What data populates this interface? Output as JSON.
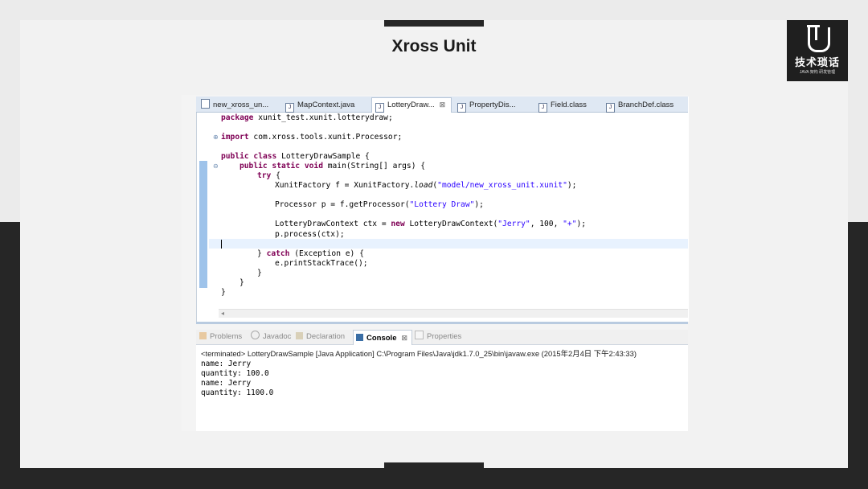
{
  "slide": {
    "title": "Xross Unit"
  },
  "logo": {
    "letter": "J",
    "name": "技术琐话",
    "sub": "JAVA 架构 研发管理"
  },
  "editor_tabs": [
    {
      "label": "new_xross_un...",
      "icon": "xross-file-icon"
    },
    {
      "label": "MapContext.java",
      "icon": "java-file-icon"
    },
    {
      "label": "LotteryDraw...",
      "icon": "java-file-icon",
      "active": true,
      "close": "⊠"
    },
    {
      "label": "PropertyDis...",
      "icon": "java-file-icon"
    },
    {
      "label": "Field.class",
      "icon": "class-file-icon"
    },
    {
      "label": "BranchDef.class",
      "icon": "class-file-icon"
    }
  ],
  "code": {
    "l1_kw": "package",
    "l1_rest": " xunit_test.xunit.lotterydraw;",
    "l2_kw": "import",
    "l2_rest": " com.xross.tools.xunit.Processor;",
    "l3_kw": "public class",
    "l3_rest": " LotteryDrawSample {",
    "l4_kw": "public static void",
    "l4_rest": " main(String[] args) {",
    "l5_kw": "try",
    "l5_rest": " {",
    "l6_a": "XunitFactory f = XunitFactory.",
    "l6_it": "load",
    "l6_b": "(",
    "l6_str": "\"model/new_xross_unit.xunit\"",
    "l6_c": ");",
    "l7_a": "Processor p = f.getProcessor(",
    "l7_str": "\"Lottery Draw\"",
    "l7_c": ");",
    "l8_a": "LotteryDrawContext ctx = ",
    "l8_kw": "new",
    "l8_b": " LotteryDrawContext(",
    "l8_str1": "\"Jerry\"",
    "l8_c": ", 100, ",
    "l8_str2": "\"+\"",
    "l8_d": ");",
    "l9": "p.process(ctx);",
    "l10_a": "} ",
    "l10_kw": "catch",
    "l10_b": " (Exception e) {",
    "l11": "e.printStackTrace();",
    "l12": "}",
    "l13": "}",
    "l14": "}"
  },
  "view_tabs": [
    {
      "label": "Problems",
      "icon": "problems-icon"
    },
    {
      "label": "Javadoc",
      "icon": "javadoc-icon"
    },
    {
      "label": "Declaration",
      "icon": "declaration-icon"
    },
    {
      "label": "Console",
      "icon": "console-icon",
      "active": true,
      "close": "⊠"
    },
    {
      "label": "Properties",
      "icon": "properties-icon"
    }
  ],
  "console": {
    "terminated": "<terminated> LotteryDrawSample [Java Application] C:\\Program Files\\Java\\jdk1.7.0_25\\bin\\javaw.exe (2015年2月4日 下午2:43:33)",
    "output": [
      "name: Jerry",
      "quantity: 100.0",
      "name: Jerry",
      "quantity: 1100.0"
    ]
  },
  "colors": {
    "keyword": "#7f0055",
    "string": "#2a00ff",
    "tabbar": "#dfe8f3",
    "dark": "#262626"
  }
}
